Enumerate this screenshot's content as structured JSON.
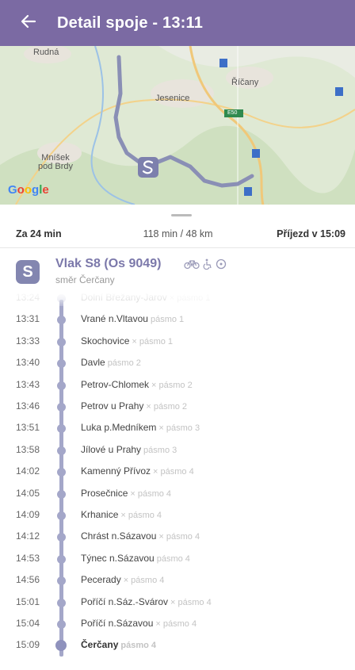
{
  "header": {
    "title": "Detail spoje - 13:11",
    "back_icon": "arrow-left-icon",
    "background": "#7b6aa3"
  },
  "map": {
    "places": [
      "Rudná",
      "Říčany",
      "Jesenice",
      "E50",
      "Mníšek pod Brdy"
    ],
    "mnisek_line1": "Mníšek",
    "mnisek_line2": "pod Brdy",
    "google": "Google",
    "route_color": "#8a8fb5"
  },
  "summary": {
    "departs_in": "Za 24 min",
    "duration": "118 min / 48 km",
    "arrival": "Příjezd v 15:09"
  },
  "line": {
    "badge": "S",
    "title": "Vlak S8 (Os 9049)",
    "direction": "směr Čerčany",
    "icons": [
      "bicycle-icon",
      "wheelchair-icon",
      "clock-icon"
    ]
  },
  "stops": [
    {
      "time": "13:24",
      "name": "Dolní Břežany-Jarov",
      "zone": "× pásmo 1",
      "faded": true
    },
    {
      "time": "13:31",
      "name": "Vrané n.Vltavou",
      "zone": "pásmo 1"
    },
    {
      "time": "13:33",
      "name": "Skochovice",
      "zone": "× pásmo 1"
    },
    {
      "time": "13:40",
      "name": "Davle",
      "zone": "pásmo 2"
    },
    {
      "time": "13:43",
      "name": "Petrov-Chlomek",
      "zone": "× pásmo 2"
    },
    {
      "time": "13:46",
      "name": "Petrov u Prahy",
      "zone": "× pásmo 2"
    },
    {
      "time": "13:51",
      "name": "Luka p.Medníkem",
      "zone": "× pásmo 3"
    },
    {
      "time": "13:58",
      "name": "Jílové u Prahy",
      "zone": "pásmo 3"
    },
    {
      "time": "14:02",
      "name": "Kamenný Přívoz",
      "zone": "× pásmo 4"
    },
    {
      "time": "14:05",
      "name": "Prosečnice",
      "zone": "× pásmo 4"
    },
    {
      "time": "14:09",
      "name": "Krhanice",
      "zone": "× pásmo 4"
    },
    {
      "time": "14:12",
      "name": "Chrást n.Sázavou",
      "zone": "× pásmo 4"
    },
    {
      "time": "14:53",
      "name": "Týnec n.Sázavou",
      "zone": "pásmo 4"
    },
    {
      "time": "14:56",
      "name": "Pecerady",
      "zone": "× pásmo 4"
    },
    {
      "time": "15:01",
      "name": "Poříčí n.Sáz.-Svárov",
      "zone": "× pásmo 4"
    },
    {
      "time": "15:04",
      "name": "Poříčí n.Sázavou",
      "zone": "× pásmo 4"
    },
    {
      "time": "15:09",
      "name": "Čerčany",
      "zone": "pásmo 4",
      "end": true
    }
  ]
}
